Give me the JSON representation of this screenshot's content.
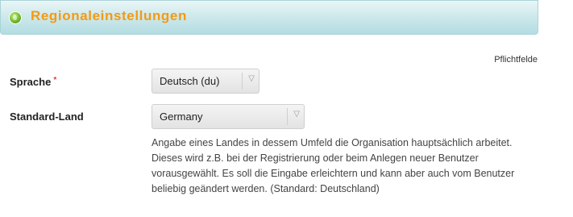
{
  "header": {
    "title": "Regionaleinstellungen",
    "icon": "globe-icon"
  },
  "form": {
    "required_note": "Pflichtfelde",
    "language": {
      "label": "Sprache",
      "required_marker": "*",
      "selected": "Deutsch (du)"
    },
    "country": {
      "label": "Standard-Land",
      "selected": "Germany",
      "help_text": "Angabe eines Landes in dessem Umfeld die Organisation hauptsächlich arbeitet. Dieses wird z.B. bei der Registrierung oder beim Anlegen neuer Benutzer vorausgewählt. Es soll die Eingabe erleichtern und kann aber auch vom Benutzer beliebig geändert werden. (Standard: Deutschland)"
    }
  },
  "colors": {
    "accent": "#f39a12",
    "required": "#e23a3a",
    "header_bg": "#cfe9ec"
  }
}
